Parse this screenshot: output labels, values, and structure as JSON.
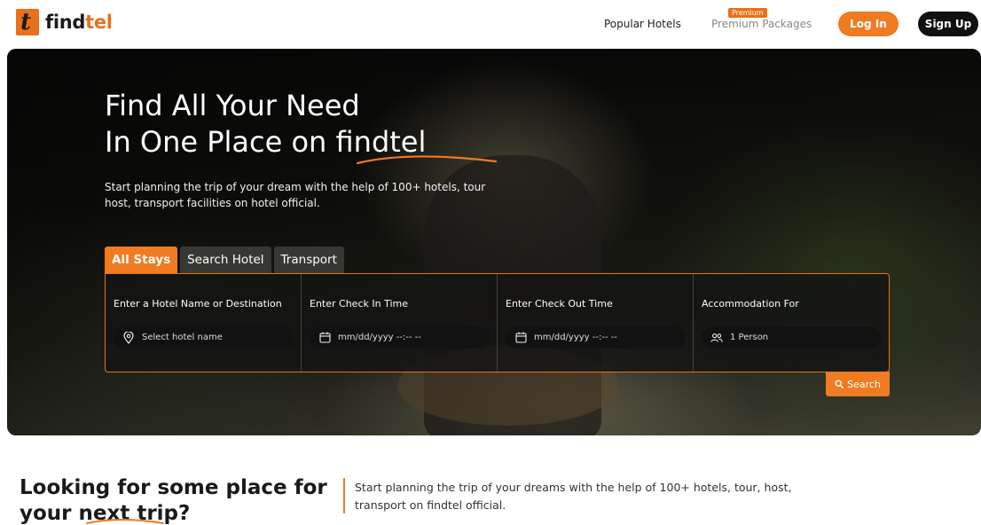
{
  "brand": {
    "logo_letter": "t",
    "name_prefix": "find",
    "name_suffix": "tel",
    "accent_color": "#ef7b22"
  },
  "nav": {
    "popular_hotels": "Popular Hotels",
    "premium_badge": "Premium",
    "premium_packages": "Premium Packages",
    "login": "Log In",
    "signup": "Sign Up"
  },
  "hero": {
    "title_line1": "Find All Your Need",
    "title_line2": "In One Place on findtel",
    "subtitle": "Start planning the trip of your dream with the help of 100+ hotels, tour host, transport facilities on hotel official."
  },
  "tabs": [
    {
      "label": "All Stays",
      "active": true
    },
    {
      "label": "Search Hotel",
      "active": false
    },
    {
      "label": "Transport",
      "active": false
    }
  ],
  "search": {
    "fields": [
      {
        "label": "Enter a Hotel Name or Destination",
        "placeholder": "Select hotel name",
        "icon": "location-pin-icon"
      },
      {
        "label": "Enter Check In Time",
        "placeholder": "mm/dd/yyyy --:-- --",
        "icon": "calendar-icon"
      },
      {
        "label": "Enter Check Out Time",
        "placeholder": "mm/dd/yyyy --:-- --",
        "icon": "calendar-icon"
      },
      {
        "label": "Accommodation For",
        "placeholder": "1 Person",
        "icon": "people-icon"
      }
    ],
    "button": "Search"
  },
  "lower": {
    "title_line1": "Looking for some place for",
    "title_line2": "your next trip?",
    "description": "Start planning the trip of your dreams with the help of 100+ hotels, tour, host, transport on findtel official."
  }
}
